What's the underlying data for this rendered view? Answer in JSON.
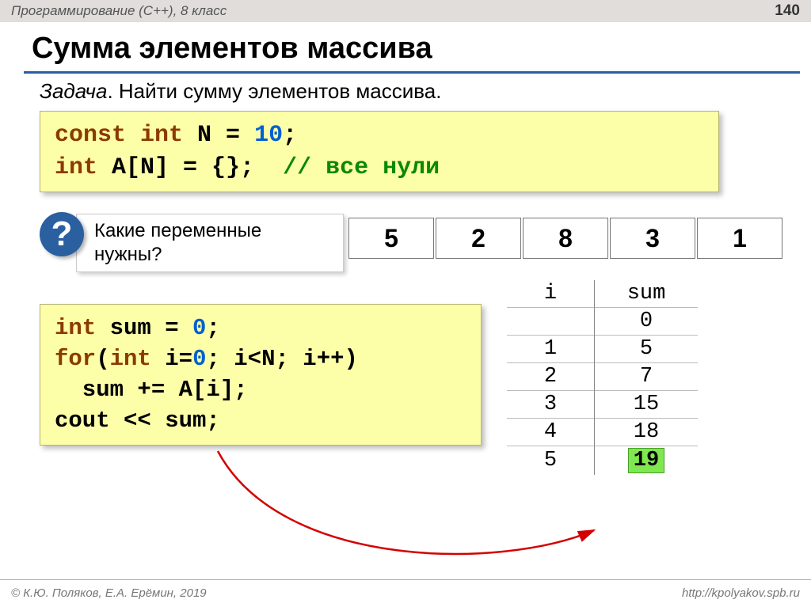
{
  "header": {
    "course": "Программирование (С++), 8 класс",
    "page": "140"
  },
  "title": "Сумма элементов массива",
  "task_label": "Задача",
  "task_text": ". Найти сумму элементов массива.",
  "code1": {
    "t1": "const int",
    "t2": " N",
    "t3": " = ",
    "t4": "10",
    "t5": ";",
    "t6": "int",
    "t7": " A[N] = {};  ",
    "t8": "// все нули"
  },
  "question_mark": "?",
  "question_text": "Какие переменные нужны?",
  "array_values": [
    "5",
    "2",
    "8",
    "3",
    "1"
  ],
  "trace": {
    "head_i": "i",
    "head_sum": "sum",
    "rows": [
      {
        "i": "",
        "sum": "0"
      },
      {
        "i": "1",
        "sum": "5"
      },
      {
        "i": "2",
        "sum": "7"
      },
      {
        "i": "3",
        "sum": "15"
      },
      {
        "i": "4",
        "sum": "18"
      },
      {
        "i": "5",
        "sum": "19"
      }
    ]
  },
  "code2": {
    "l1a": "int",
    "l1b": " sum = ",
    "l1c": "0",
    "l1d": ";",
    "l2a": "for",
    "l2b": "(",
    "l2c": "int",
    "l2d": " i=",
    "l2e": "0",
    "l2f": "; i<N; i++)",
    "l3": "  sum += A[i];",
    "l4a": "cout << sum;"
  },
  "footer": {
    "left": "© К.Ю. Поляков, Е.А. Ерёмин, 2019",
    "right": "http://kpolyakov.spb.ru"
  }
}
